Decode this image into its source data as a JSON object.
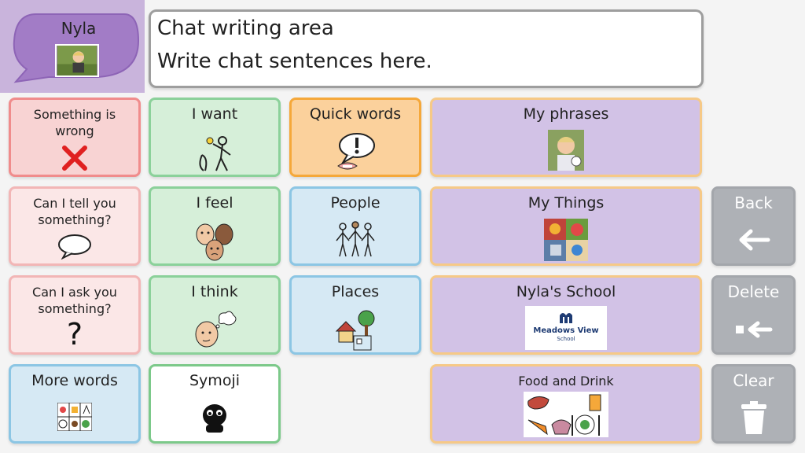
{
  "user": {
    "name": "Nyla"
  },
  "chat": {
    "title": "Chat writing area",
    "placeholder": "Write chat sentences here."
  },
  "tiles": {
    "something_wrong": "Something is wrong",
    "i_want": "I want",
    "quick_words": "Quick words",
    "my_phrases": "My phrases",
    "tell_you": "Can I tell you something?",
    "i_feel": "I feel",
    "people": "People",
    "my_things": "My Things",
    "ask_you": "Can I ask you something?",
    "i_think": "I think",
    "places": "Places",
    "nylas_school": "Nyla's School",
    "more_words": "More words",
    "symoji": "Symoji",
    "food_drink": "Food and Drink"
  },
  "school_logo": {
    "line1": "Meadows View",
    "line2": "School"
  },
  "controls": {
    "back": "Back",
    "delete": "Delete",
    "clear": "Clear"
  },
  "question_glyph": "?",
  "colors": {
    "user_panel": "#c9b4dc",
    "bubble": "#a27cc6",
    "red": "#f8d3d3",
    "green": "#d6efd9",
    "orange": "#fbd19c",
    "blue": "#d6e9f4",
    "purple": "#d2c2e6",
    "grey": "#aeb1b6"
  }
}
